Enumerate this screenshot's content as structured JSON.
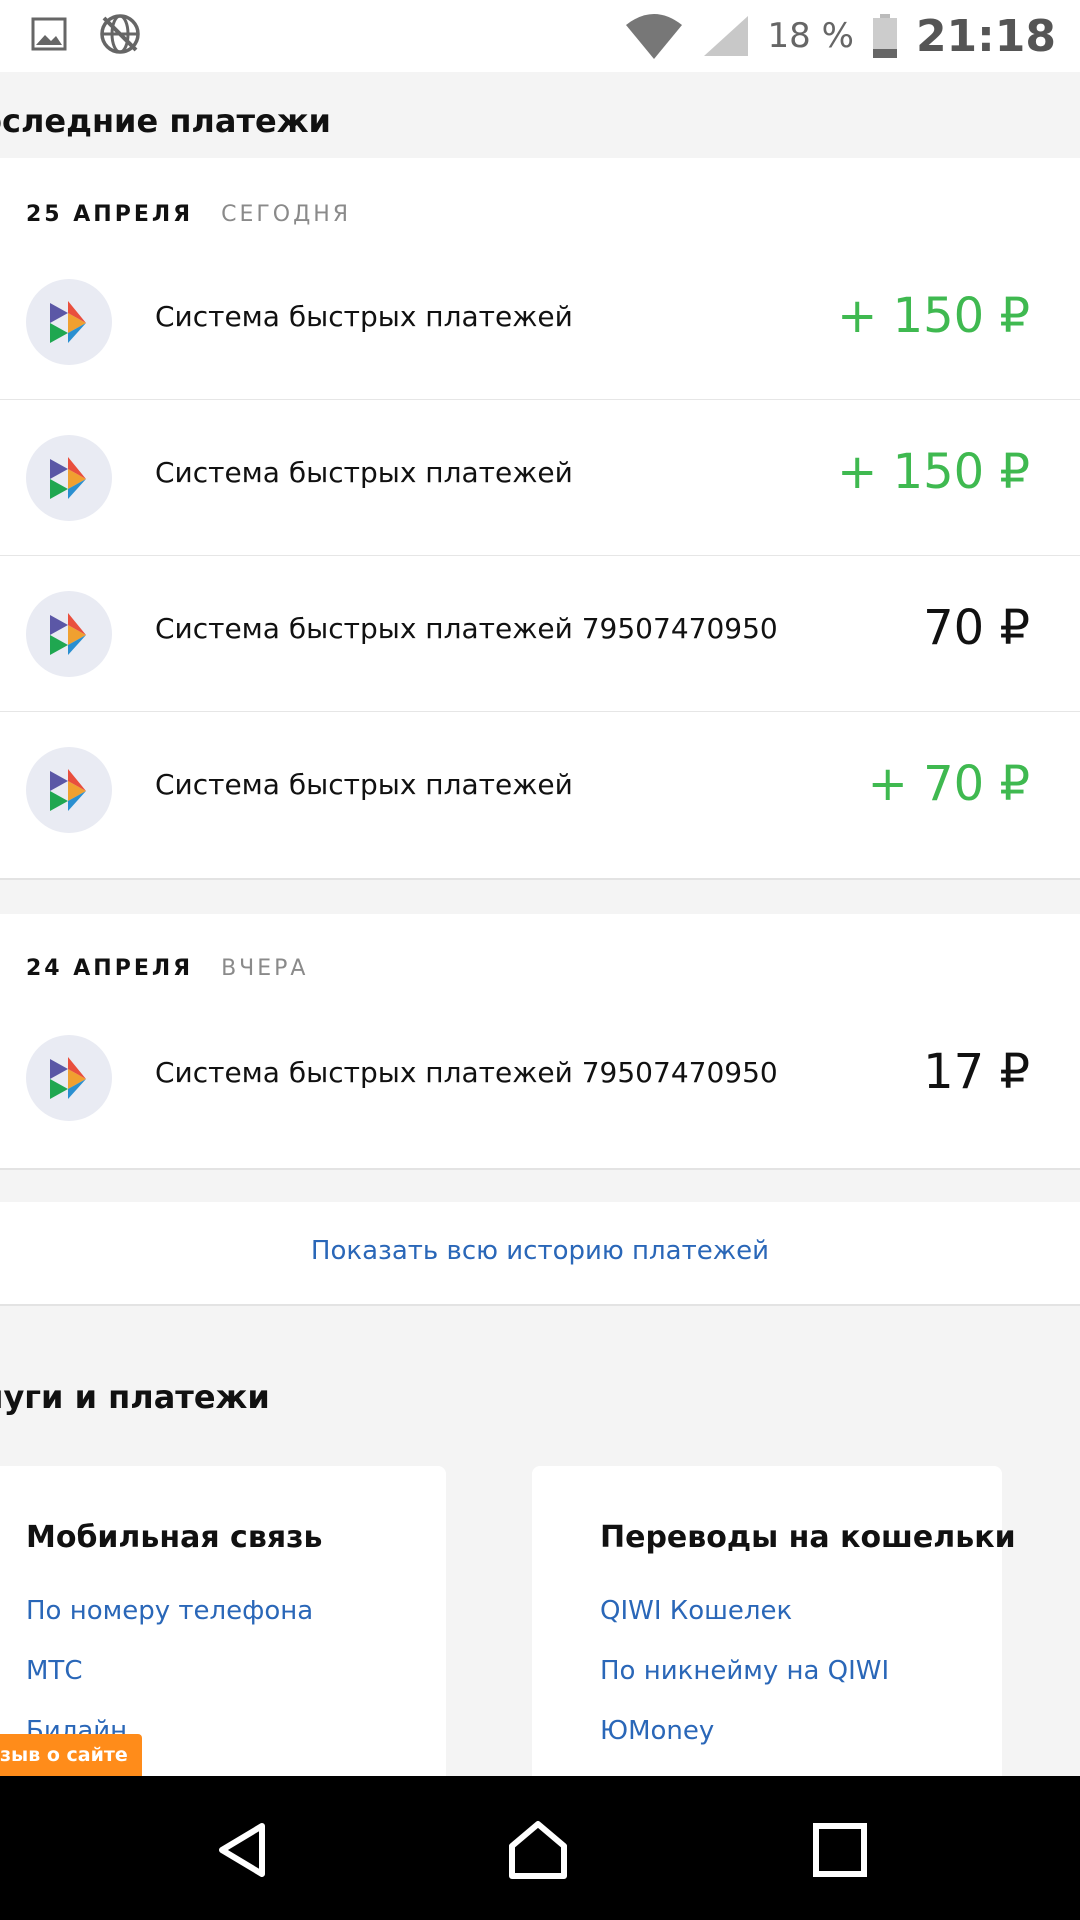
{
  "status_bar": {
    "battery_percent": "18 %",
    "time": "21:18",
    "icons": [
      "image-icon",
      "no-network-icon",
      "wifi-icon",
      "signal-icon",
      "battery-icon"
    ]
  },
  "recent_payments": {
    "title": "оследние платежи",
    "groups": [
      {
        "date": "25 АПРЕЛЯ",
        "relative": "СЕГОДНЯ",
        "items": [
          {
            "title": "Система быстрых платежей",
            "amount": "+ 150 ₽",
            "incoming": true
          },
          {
            "title": "Система быстрых платежей",
            "amount": "+ 150 ₽",
            "incoming": true
          },
          {
            "title": "Система быстрых платежей 79507470950",
            "amount": "70 ₽",
            "incoming": false
          },
          {
            "title": "Система быстрых платежей",
            "amount": "+ 70 ₽",
            "incoming": true
          }
        ]
      },
      {
        "date": "24 АПРЕЛЯ",
        "relative": "ВЧЕРА",
        "items": [
          {
            "title": "Система быстрых платежей 79507470950",
            "amount": "17 ₽",
            "incoming": false
          }
        ]
      }
    ],
    "show_all_link": "Показать всю историю платежей"
  },
  "services": {
    "title": "луги и платежи",
    "cards": [
      {
        "title": "Мобильная связь",
        "links": [
          "По номеру телефона",
          "МТС",
          "Билайн"
        ]
      },
      {
        "title": "Переводы на кошельки",
        "links": [
          "QIWI Кошелек",
          "По никнейму на QIWI",
          "ЮMoney"
        ]
      }
    ]
  },
  "feedback_button": "зыв о сайте",
  "colors": {
    "income_green": "#3fb950",
    "link_blue": "#2a67b8",
    "accent_orange": "#ff8c1a"
  }
}
